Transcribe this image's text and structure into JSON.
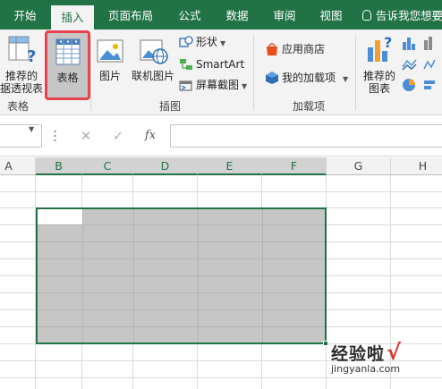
{
  "tabs": {
    "start": "开始",
    "insert": "插入",
    "page_layout": "页面布局",
    "formulas": "公式",
    "data": "数据",
    "review": "审阅",
    "view": "视图"
  },
  "tell_me": "告诉我您想要",
  "ribbon": {
    "recommended_pivot_line1": "推荐的",
    "recommended_pivot_line2": "据透视表",
    "table": "表格",
    "tables_group": "表格",
    "picture": "图片",
    "online_picture": "联机图片",
    "shapes": "形状",
    "smartart": "SmartArt",
    "screenshot": "屏幕截图",
    "illustrations_group": "插图",
    "store": "应用商店",
    "my_addins": "我的加载项",
    "addins_group": "加载项",
    "recommended_charts_line1": "推荐的",
    "recommended_charts_line2": "图表"
  },
  "formula_bar": {
    "fx": "fx",
    "cancel": "✕",
    "enter": "✓"
  },
  "columns": [
    "A",
    "B",
    "C",
    "D",
    "E",
    "F",
    "G",
    "H"
  ],
  "selected_columns": [
    "B",
    "C",
    "D",
    "E",
    "F"
  ],
  "colors": {
    "accent": "#217346",
    "highlight_box": "#e8424e",
    "selection_fill": "#c6c6c6"
  },
  "watermark": {
    "text": "经验啦",
    "url": "jingyanla.com"
  }
}
